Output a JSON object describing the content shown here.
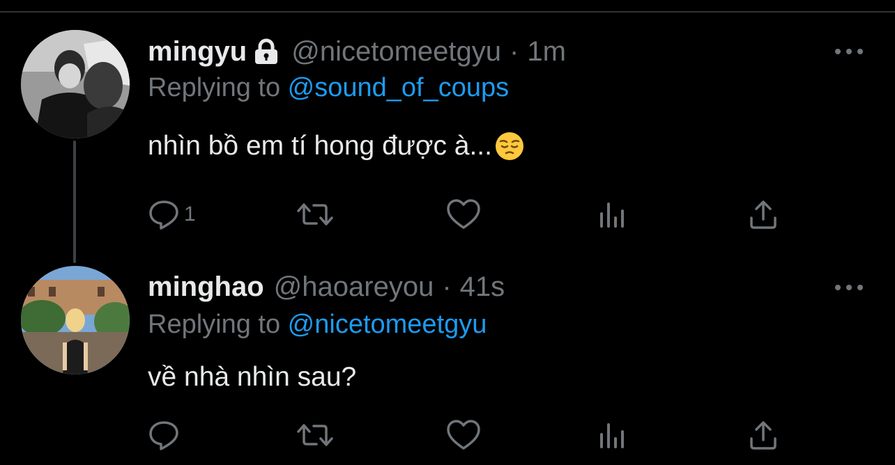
{
  "tweets": [
    {
      "display_name": "mingyu",
      "protected": true,
      "handle": "@nicetomeetgyu",
      "separator": "·",
      "time": "1m",
      "replying_prefix": "Replying to ",
      "replying_to": "@sound_of_coups",
      "text": "nhìn bồ em tí hong được à...",
      "emoji": "pensive-face",
      "reply_count": "1",
      "retweet_count": "",
      "like_count": ""
    },
    {
      "display_name": "minghao",
      "protected": false,
      "handle": "@haoareyou",
      "separator": "·",
      "time": "41s",
      "replying_prefix": "Replying to ",
      "replying_to": "@nicetomeetgyu",
      "text": "về nhà nhìn sau?",
      "reply_count": "",
      "retweet_count": "",
      "like_count": ""
    }
  ],
  "colors": {
    "background": "#000000",
    "text_primary": "#e7e9ea",
    "text_secondary": "#71767b",
    "accent": "#1d9bf0"
  },
  "icons": [
    "lock-icon",
    "more-icon",
    "reply-icon",
    "retweet-icon",
    "like-icon",
    "views-icon",
    "share-icon"
  ]
}
